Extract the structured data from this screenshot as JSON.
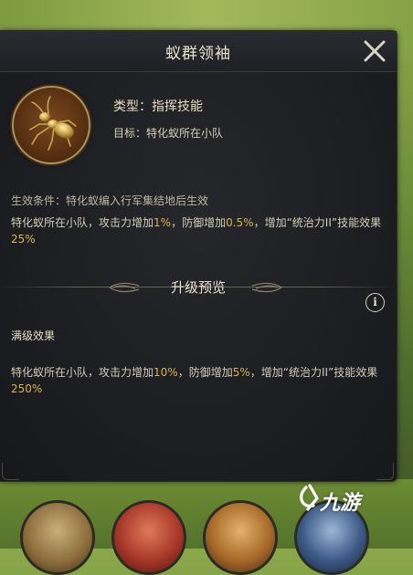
{
  "panel": {
    "title": "蚁群领袖",
    "skill": {
      "icon": "golden-ant-icon",
      "type_line": "类型：指挥技能",
      "target_line": "目标：特化蚁所在小队"
    },
    "condition": "生效条件：特化蚁编入行军集结地后生效",
    "effect": {
      "part1": "特化蚁所在小队，攻击力增加",
      "attack_value": "1%",
      "part2": "，防御增加",
      "defense_value": "0.5%",
      "part3": "，增加“统治力II”技能效果",
      "skill_value": "25%"
    },
    "upgrade_title": "升级预览",
    "info_label": "i",
    "max_label": "满级效果",
    "max_effect": {
      "part1": "特化蚁所在小队，攻击力增加",
      "attack_value": "10%",
      "part2": "，防御增加",
      "defense_value": "5%",
      "part3": "，增加“统治力II”技能效果",
      "skill_value": "250%"
    }
  },
  "watermark": {
    "text": "九游",
    "icon": "jiuyou-logo-icon"
  },
  "colors": {
    "highlight": "#d9b24a",
    "panel_bg": "#1d1e22",
    "text": "#d4ccb8",
    "grass": "#6f8e3a"
  }
}
